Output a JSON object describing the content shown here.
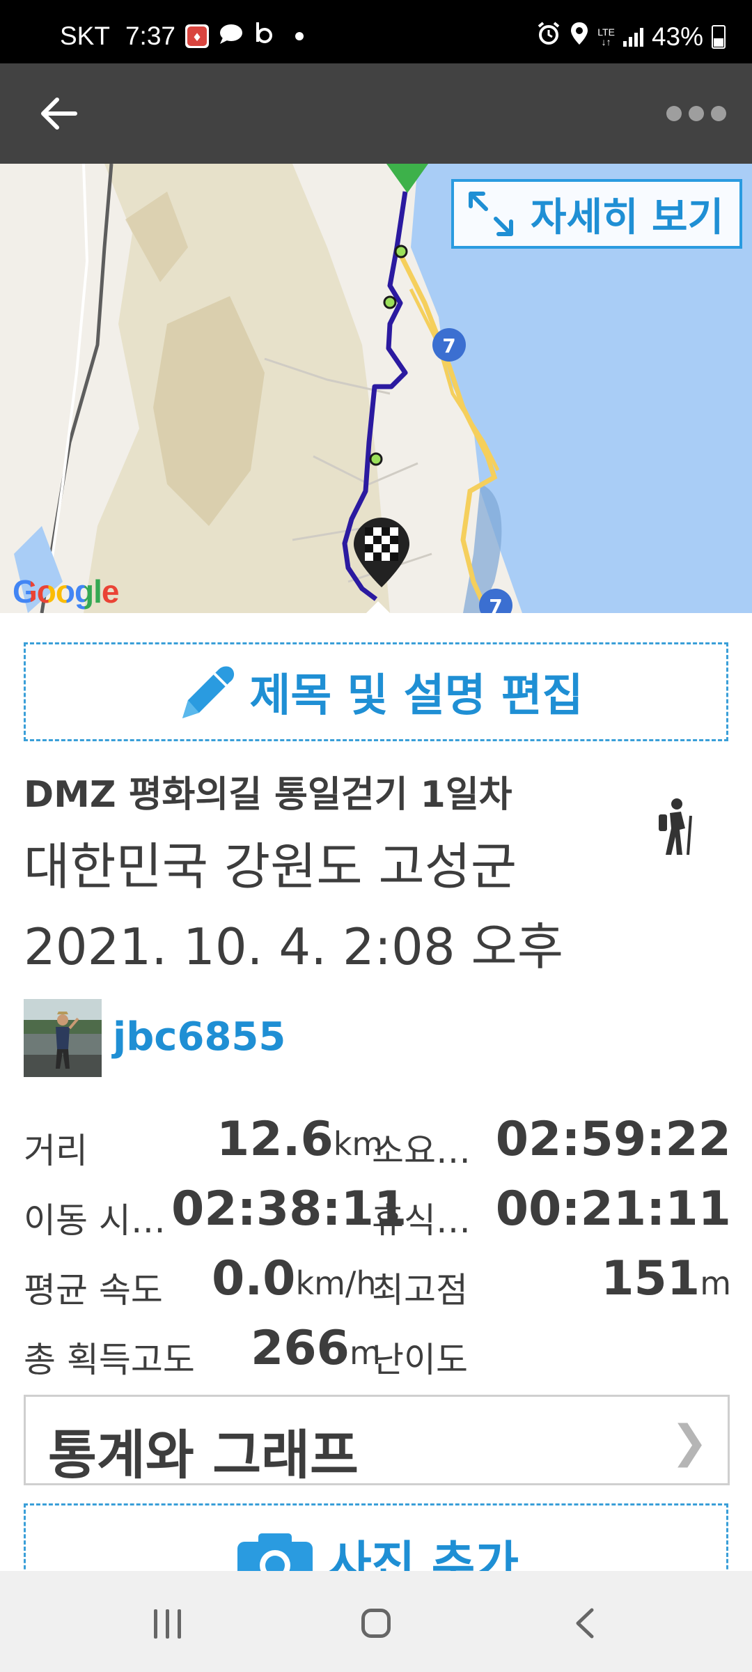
{
  "status_bar": {
    "carrier": "SKT",
    "time": "7:37",
    "network": "LTE",
    "battery": "43%",
    "icons": [
      "notification-app-icon",
      "chat-icon",
      "b-app-icon",
      "dot-icon",
      "alarm-icon",
      "location-icon",
      "lte-icon",
      "signal-icon",
      "battery-icon"
    ]
  },
  "app_bar": {
    "back_icon": "arrow-left-icon",
    "more_icon": "more-dots-icon"
  },
  "map": {
    "detail_button": "자세히 보기",
    "attribution": "Google",
    "road_label": "7",
    "colors": {
      "route": "#2b1aa0",
      "water": "#a9cdf6",
      "road": "#f5cf5c",
      "land": "#f2efe9"
    }
  },
  "edit_button": {
    "label": "제목 및 설명 편집",
    "icon": "pencil-icon"
  },
  "trip": {
    "name": "DMZ 평화의길 통일걷기 1일차",
    "location": "대한민국 강원도 고성군",
    "datetime": "2021. 10. 4. 2:08 오후",
    "activity_icon": "hiking-icon"
  },
  "user": {
    "username": "jbc6855"
  },
  "stats": {
    "distance": {
      "label": "거리",
      "value": "12.6",
      "unit": "km"
    },
    "total_time": {
      "label": "소요…",
      "value": "02:59:22"
    },
    "moving_time": {
      "label": "이동 시…",
      "value": "02:38:11"
    },
    "rest_time": {
      "label": "휴식…",
      "value": "00:21:11"
    },
    "avg_speed": {
      "label": "평균 속도",
      "value": "0.0",
      "unit": "km/h"
    },
    "max_altitude": {
      "label": "최고점",
      "value": "151",
      "unit": "m"
    },
    "elevation_gain": {
      "label": "총 획득고도",
      "value": "266",
      "unit": "m"
    },
    "difficulty": {
      "label": "난이도",
      "value": ""
    }
  },
  "stats_button": {
    "label": "통계와 그래프",
    "chevron": "❯"
  },
  "photo_button": {
    "label": "사진 추가",
    "icon": "camera-icon"
  },
  "nav_bar": {
    "icons": [
      "recents-icon",
      "home-icon",
      "back-icon"
    ]
  }
}
